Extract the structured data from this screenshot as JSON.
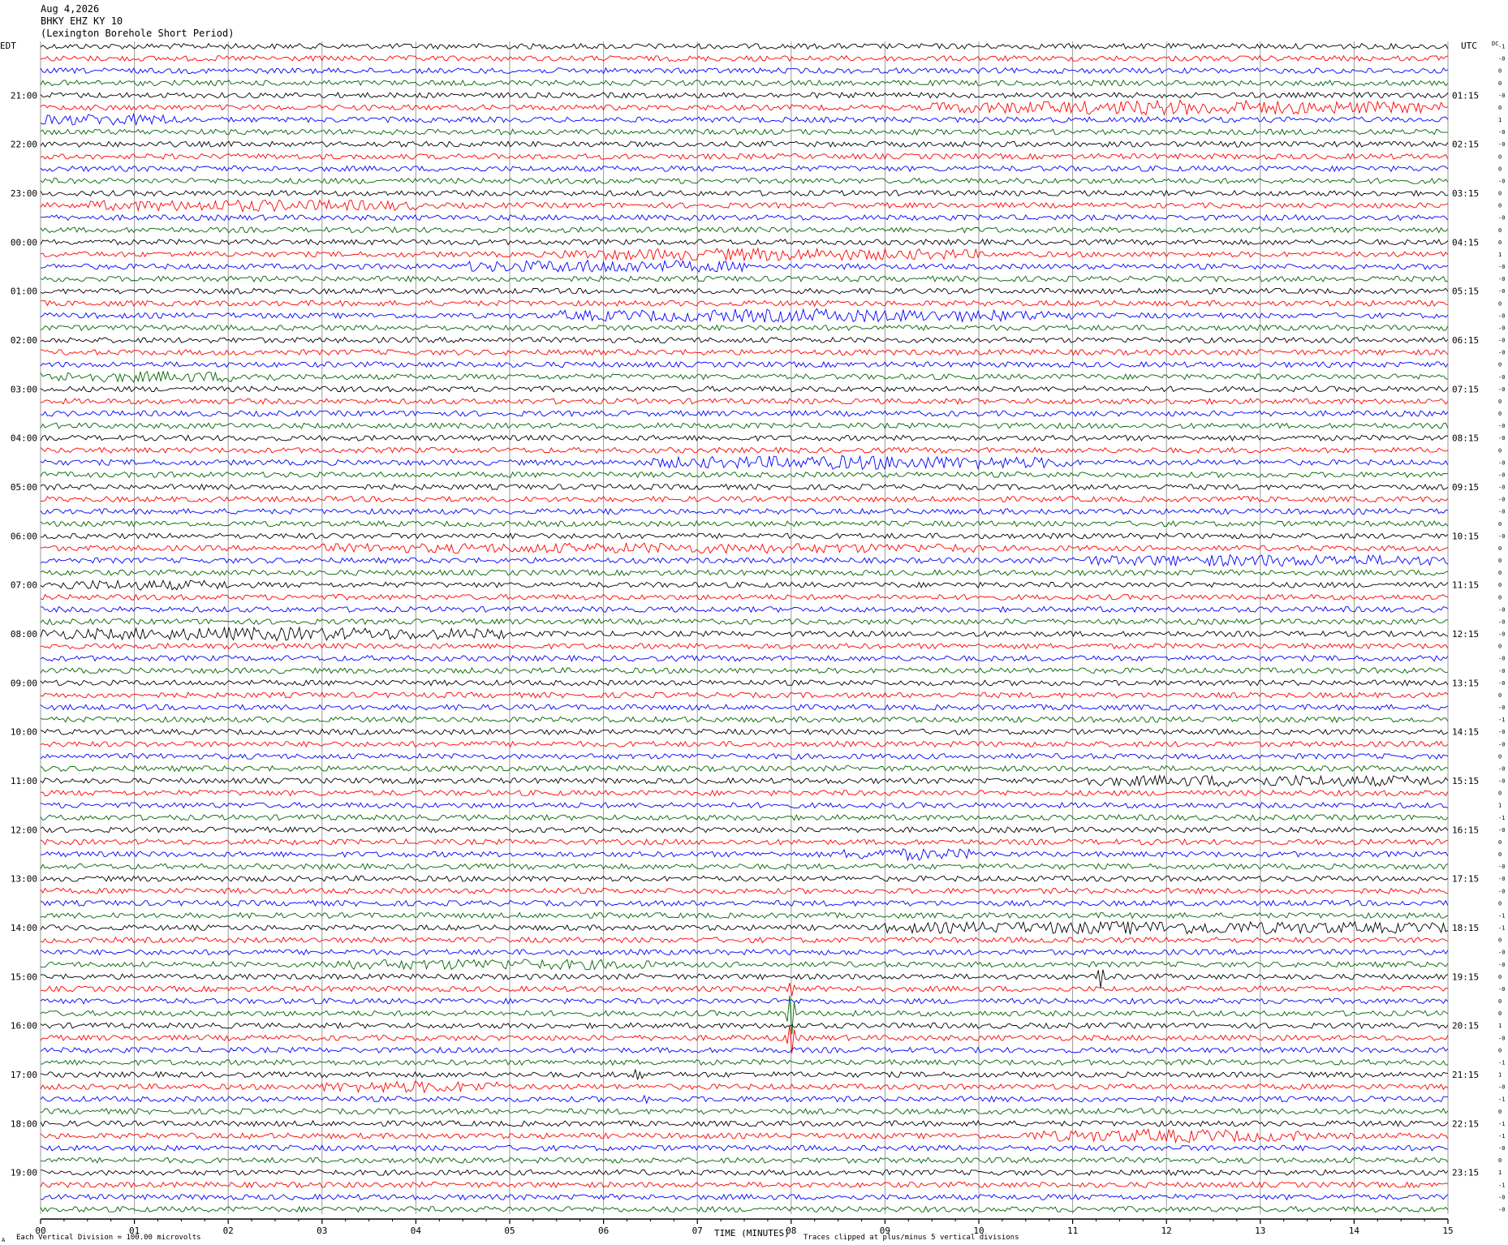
{
  "header": {
    "date": "Aug 4,2026",
    "station": "BHKY EHZ KY 10",
    "description": "(Lexington Borehole Short Period)"
  },
  "left_timezone": "EDT",
  "right_timezone": "UTC",
  "dc_label": "DC",
  "chart_data": {
    "type": "helicorder",
    "minutes_per_line": 15,
    "line_count": 96,
    "colors": [
      "#000000",
      "#ff0000",
      "#0000ff",
      "#006400"
    ],
    "left_hour_labels": [
      "21:00",
      "22:00",
      "23:00",
      "00:00",
      "01:00",
      "02:00",
      "03:00",
      "04:00",
      "05:00",
      "06:00",
      "07:00",
      "08:00",
      "09:00",
      "10:00",
      "11:00",
      "12:00",
      "13:00",
      "14:00",
      "15:00",
      "16:00",
      "17:00",
      "18:00",
      "19:00"
    ],
    "right_hour_labels": [
      "01:15",
      "02:15",
      "03:15",
      "04:15",
      "05:15",
      "06:15",
      "07:15",
      "08:15",
      "09:15",
      "10:15",
      "11:15",
      "12:15",
      "13:15",
      "14:15",
      "15:15",
      "16:15",
      "17:15",
      "18:15",
      "19:15",
      "20:15",
      "21:15",
      "22:15",
      "23:15"
    ],
    "x_tick_labels": [
      "00",
      "01",
      "02",
      "03",
      "04",
      "05",
      "06",
      "07",
      "08",
      "09",
      "10",
      "11",
      "12",
      "13",
      "14",
      "15"
    ],
    "xlabel": "TIME (MINUTES)",
    "dc_offsets": [
      "-1",
      "-0",
      "0",
      "0",
      "-0",
      "0",
      "1",
      "-0",
      "-0",
      "0",
      "0",
      "-0",
      "0",
      "0",
      "-0",
      "0",
      "0",
      "1",
      "-0",
      "-0",
      "-0",
      "0",
      "-0",
      "-0",
      "-0",
      "-0",
      "0",
      "-0",
      "-0",
      "0",
      "0",
      "-0",
      "-0",
      "0",
      "-0",
      "-0",
      "-0",
      "-0",
      "-0",
      "0",
      "-0",
      "0",
      "0",
      "0",
      "0",
      "0",
      "-0",
      "-0",
      "-0",
      "0",
      "-0",
      "-0",
      "-0",
      "0",
      "-0",
      "-1",
      "-0",
      "-0",
      "0",
      "-0",
      "-0",
      "0",
      "1",
      "-1",
      "-0",
      "0",
      "0",
      "-0",
      "-0",
      "-0",
      "0",
      "-1",
      "-1",
      "0",
      "-0",
      "-0",
      "0",
      "-0",
      "0",
      "0",
      "1",
      "-0",
      "0",
      "-1",
      "1",
      "-0",
      "-1",
      "0",
      "-1",
      "-1",
      "-0",
      "0",
      "1",
      "-1",
      "-0",
      "-0"
    ],
    "events": [
      {
        "line": 5,
        "start_min": 9.5,
        "end_min": 15,
        "amplitude": 2.0
      },
      {
        "line": 6,
        "start_min": 0.0,
        "end_min": 1.5,
        "amplitude": 1.6
      },
      {
        "line": 13,
        "start_min": 0.5,
        "end_min": 4.0,
        "amplitude": 1.6
      },
      {
        "line": 17,
        "start_min": 5.5,
        "end_min": 10.0,
        "amplitude": 1.7
      },
      {
        "line": 18,
        "start_min": 4.5,
        "end_min": 7.5,
        "amplitude": 1.8
      },
      {
        "line": 22,
        "start_min": 5.5,
        "end_min": 11.0,
        "amplitude": 1.8
      },
      {
        "line": 27,
        "start_min": 0.0,
        "end_min": 2.5,
        "amplitude": 1.5
      },
      {
        "line": 34,
        "start_min": 6.5,
        "end_min": 11.0,
        "amplitude": 1.9
      },
      {
        "line": 41,
        "start_min": 3.0,
        "end_min": 10.0,
        "amplitude": 1.4
      },
      {
        "line": 42,
        "start_min": 11.0,
        "end_min": 15.0,
        "amplitude": 1.6
      },
      {
        "line": 44,
        "start_min": 0.0,
        "end_min": 2.0,
        "amplitude": 1.4
      },
      {
        "line": 48,
        "start_min": 0.0,
        "end_min": 5.0,
        "amplitude": 1.8
      },
      {
        "line": 60,
        "start_min": 11.0,
        "end_min": 15.0,
        "amplitude": 1.6
      },
      {
        "line": 66,
        "start_min": 8.5,
        "end_min": 10.0,
        "amplitude": 1.6
      },
      {
        "line": 72,
        "start_min": 9.0,
        "end_min": 15.0,
        "amplitude": 1.8
      },
      {
        "line": 75,
        "start_min": 3.0,
        "end_min": 6.5,
        "amplitude": 1.5
      },
      {
        "line": 84,
        "start_min": 6.3,
        "end_min": 6.45,
        "amplitude": 3.0
      },
      {
        "line": 85,
        "start_min": 3.0,
        "end_min": 5.0,
        "amplitude": 1.6
      },
      {
        "line": 89,
        "start_min": 10.5,
        "end_min": 13.5,
        "amplitude": 1.8
      }
    ],
    "spikes": [
      {
        "line": 76,
        "minute": 11.3,
        "amplitude": 14
      },
      {
        "line": 77,
        "minute": 8.0,
        "amplitude": 10
      },
      {
        "line": 79,
        "minute": 8.0,
        "amplitude": 30
      },
      {
        "line": 81,
        "minute": 8.0,
        "amplitude": 22
      },
      {
        "line": 84,
        "minute": 6.35,
        "amplitude": 8
      },
      {
        "line": 86,
        "minute": 6.45,
        "amplitude": 6
      }
    ],
    "footer_left": "Each Vertical Division =  100.00 microvolts",
    "footer_right": "Traces clipped at plus/minus 5 vertical divisions",
    "corner_mark": "A"
  }
}
